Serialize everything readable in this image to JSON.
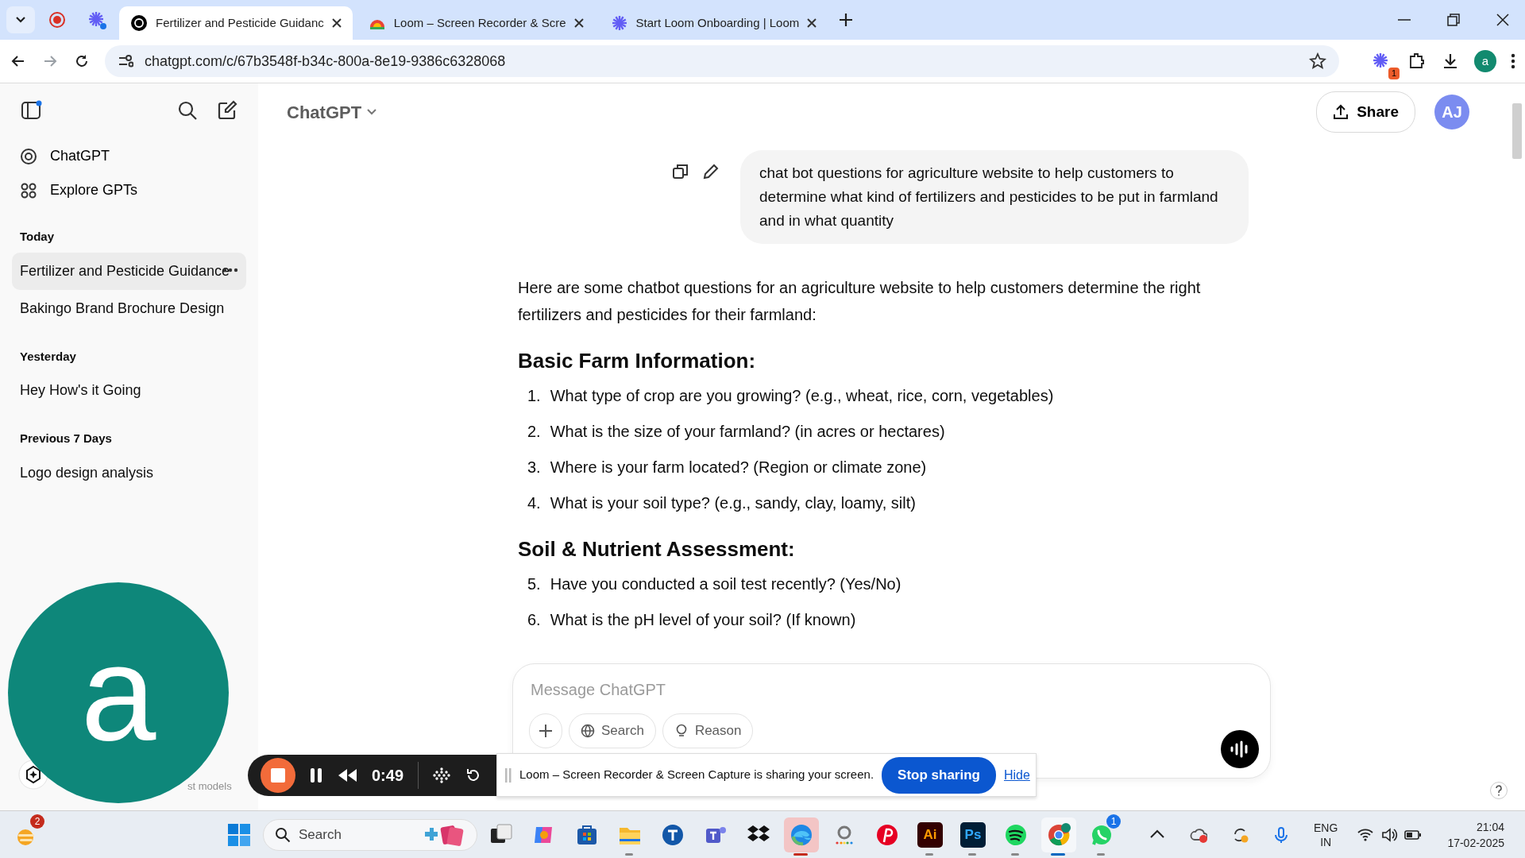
{
  "browser": {
    "tabs": [
      {
        "kind": "chatgpt",
        "title": "Fertilizer and Pesticide Guidanc",
        "selected": true
      },
      {
        "kind": "loom-ext",
        "title": "Loom – Screen Recorder & Scre",
        "selected": false
      },
      {
        "kind": "loom",
        "title": "Start Loom Onboarding | Loom",
        "selected": false
      }
    ],
    "url": "chatgpt.com/c/67b3548f-b34c-800a-8e19-9386c6328068",
    "extension_badge": "1",
    "profile_initial": "a"
  },
  "sidebar": {
    "nav": [
      {
        "kind": "chatgpt",
        "label": "ChatGPT"
      },
      {
        "kind": "explore",
        "label": "Explore GPTs"
      }
    ],
    "groups": [
      {
        "label": "Today",
        "items": [
          {
            "label": "Fertilizer and Pesticide Guidance",
            "selected": true
          },
          {
            "label": "Bakingo Brand Brochure Design",
            "selected": false
          }
        ]
      },
      {
        "label": "Yesterday",
        "items": [
          {
            "label": "Hey How's it Going",
            "selected": false
          }
        ]
      },
      {
        "label": "Previous 7 Days",
        "items": [
          {
            "label": "Logo design analysis",
            "selected": false
          }
        ]
      }
    ],
    "upgrade_text": "st models"
  },
  "header": {
    "model": "ChatGPT",
    "share": "Share",
    "avatar": "AJ"
  },
  "user_message": "chat bot questions for agriculture website to help customers to determine what kind of fertilizers and pesticides to be put in farmland and in what quantity",
  "response": {
    "intro": "Here are some chatbot questions for an agriculture website to help customers determine the right fertilizers and pesticides for their farmland:",
    "sections": [
      {
        "heading": "Basic Farm Information:",
        "items": [
          {
            "number": "1.",
            "text": "What type of crop are you growing? (e.g., wheat, rice, corn, vegetables)"
          },
          {
            "number": "2.",
            "text": "What is the size of your farmland? (in acres or hectares)"
          },
          {
            "number": "3.",
            "text": "Where is your farm located? (Region or climate zone)"
          },
          {
            "number": "4.",
            "text": "What is your soil type? (e.g., sandy, clay, loamy, silt)"
          }
        ]
      },
      {
        "heading": "Soil & Nutrient Assessment:",
        "items": [
          {
            "number": "5.",
            "text": "Have you conducted a soil test recently? (Yes/No)"
          },
          {
            "number": "6.",
            "text": "What is the pH level of your soil? (If known)"
          }
        ]
      }
    ]
  },
  "composer": {
    "placeholder": "Message ChatGPT",
    "tools": [
      "Search",
      "Reason"
    ]
  },
  "loom": {
    "camera_initial": "a",
    "timer": "0:49",
    "notice": "Loom – Screen Recorder & Screen Capture is sharing your screen.",
    "stop": "Stop sharing",
    "hide": "Hide"
  },
  "taskbar": {
    "widget_badge": "2",
    "search": "Search",
    "apps": [
      {
        "kind": "taskview",
        "running": false,
        "active": false
      },
      {
        "kind": "copilot",
        "running": false,
        "active": false
      },
      {
        "kind": "store",
        "running": false,
        "active": false
      },
      {
        "kind": "files",
        "running": true,
        "active": false
      },
      {
        "kind": "tapp",
        "running": false,
        "active": false
      },
      {
        "kind": "teams",
        "running": false,
        "active": false
      },
      {
        "kind": "dropbox",
        "running": false,
        "active": false
      },
      {
        "kind": "edge",
        "running": true,
        "active": true
      },
      {
        "kind": "amazon",
        "running": false,
        "active": false
      },
      {
        "kind": "pinterest",
        "running": false,
        "active": false
      },
      {
        "kind": "illustrator",
        "label": "Ai",
        "running": true,
        "active": false
      },
      {
        "kind": "photoshop",
        "label": "Ps",
        "running": true,
        "active": false
      },
      {
        "kind": "spotify",
        "running": true,
        "active": false
      },
      {
        "kind": "chrome",
        "running": true,
        "active": true
      },
      {
        "kind": "whatsapp",
        "badge": "1",
        "running": true,
        "active": false
      }
    ],
    "language": "ENG",
    "region": "IN",
    "time": "21:04",
    "date": "17-02-2025"
  }
}
